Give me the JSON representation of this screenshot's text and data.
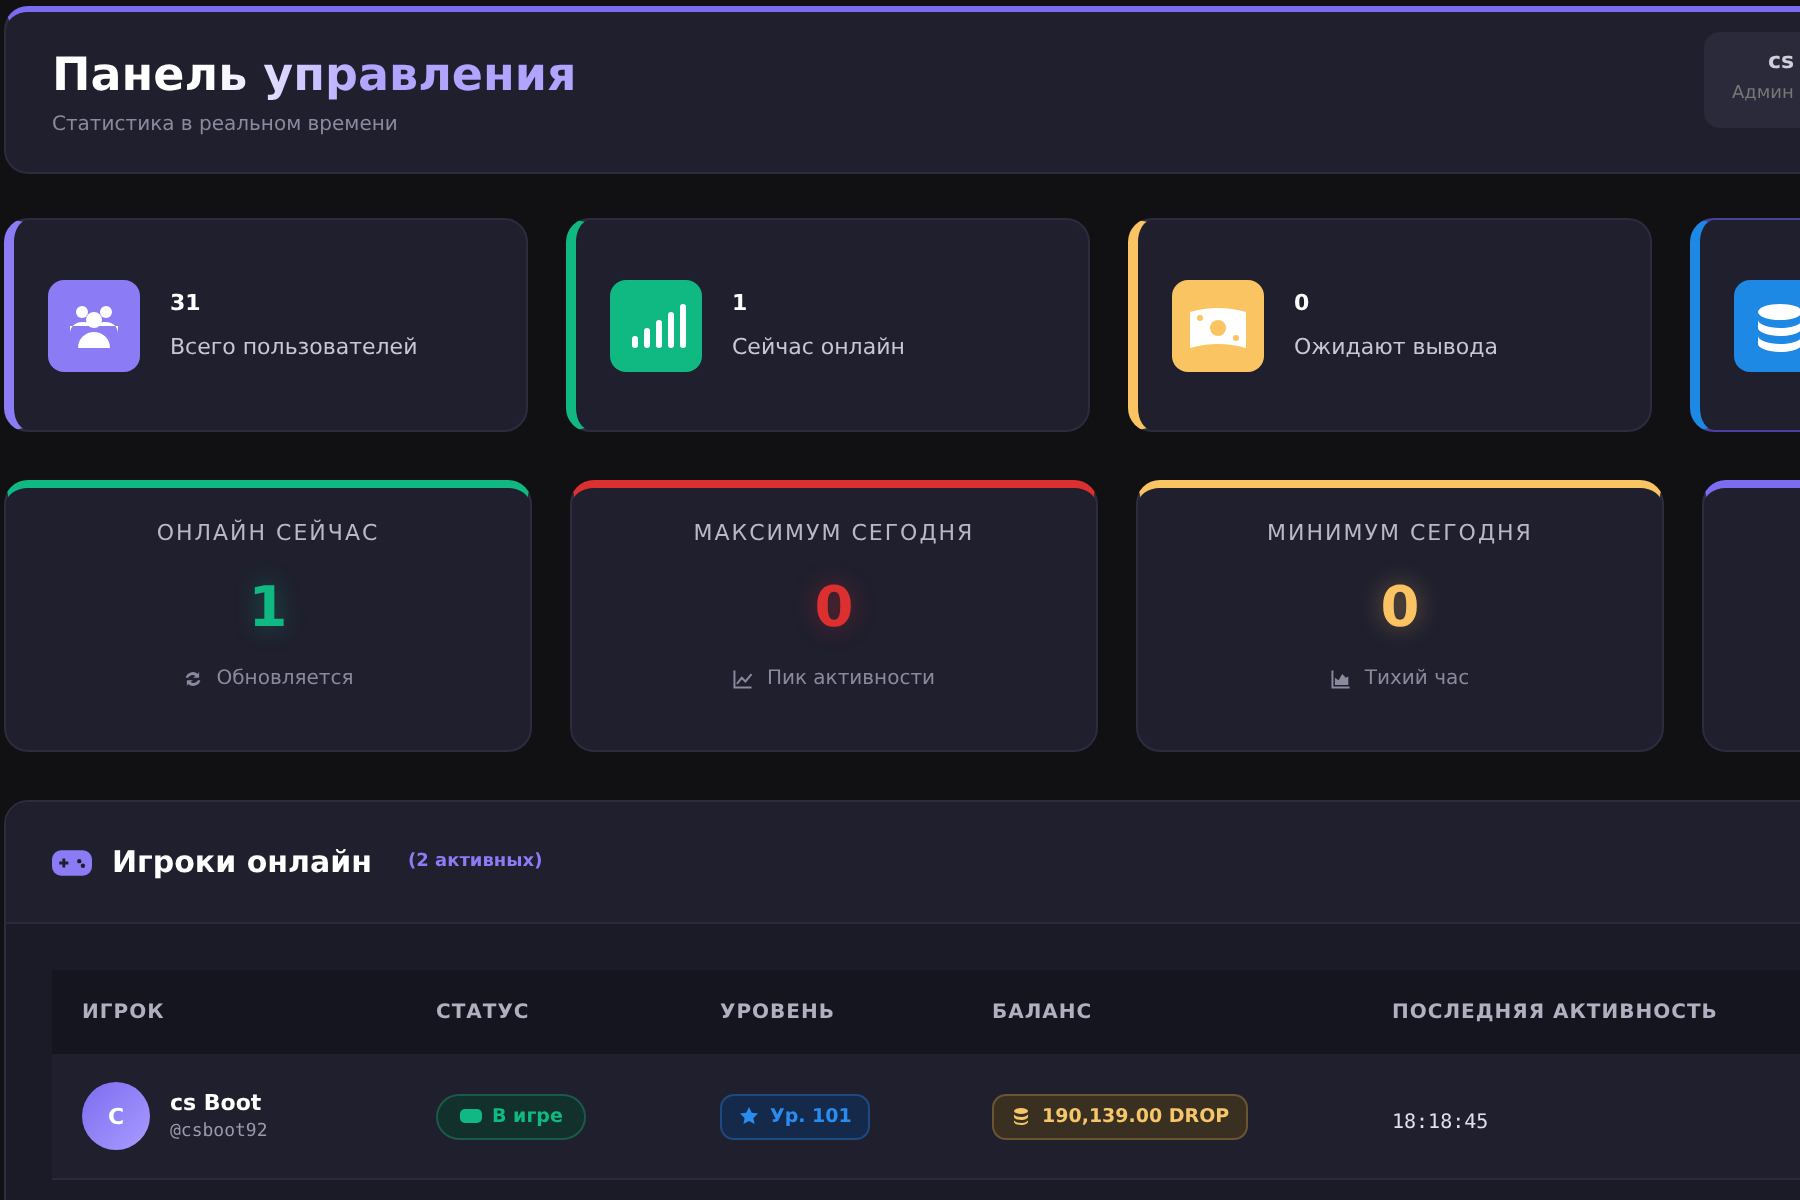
{
  "header": {
    "title": "Панель управления",
    "subtitle": "Статистика в реальном времени",
    "user": {
      "name": "cs",
      "role": "Админ"
    }
  },
  "stat_cards": [
    {
      "value": "31",
      "label": "Всего пользователей",
      "color": "#8b7cf6"
    },
    {
      "value": "1",
      "label": "Сейчас онлайн",
      "color": "#10b981"
    },
    {
      "value": "0",
      "label": "Ожидают вывода",
      "color": "#fbc463"
    },
    {
      "color": "#1e88e5"
    }
  ],
  "online_cards": [
    {
      "title": "ОНЛАЙН СЕЙЧАС",
      "value": "1",
      "note": "Обновляется",
      "color": "#10b981"
    },
    {
      "title": "МАКСИМУМ СЕГОДНЯ",
      "value": "0",
      "note": "Пик активности",
      "color": "#dc3030"
    },
    {
      "title": "МИНИМУМ СЕГОДНЯ",
      "value": "0",
      "note": "Тихий час",
      "color": "#fbc463"
    },
    {
      "color": "#7c6cf0"
    }
  ],
  "players": {
    "title": "Игроки онлайн",
    "count": "(2 активных)",
    "columns": [
      "ИГРОК",
      "СТАТУС",
      "УРОВЕНЬ",
      "БАЛАНС",
      "ПОСЛЕДНЯЯ АКТИВНОСТЬ"
    ],
    "rows": [
      {
        "avatar": "C",
        "name": "cs Boot",
        "handle": "@csboot92",
        "status": "В игре",
        "level": "Ур. 101",
        "balance": "190,139.00 DROP",
        "last_active": "18:18:45"
      }
    ]
  }
}
